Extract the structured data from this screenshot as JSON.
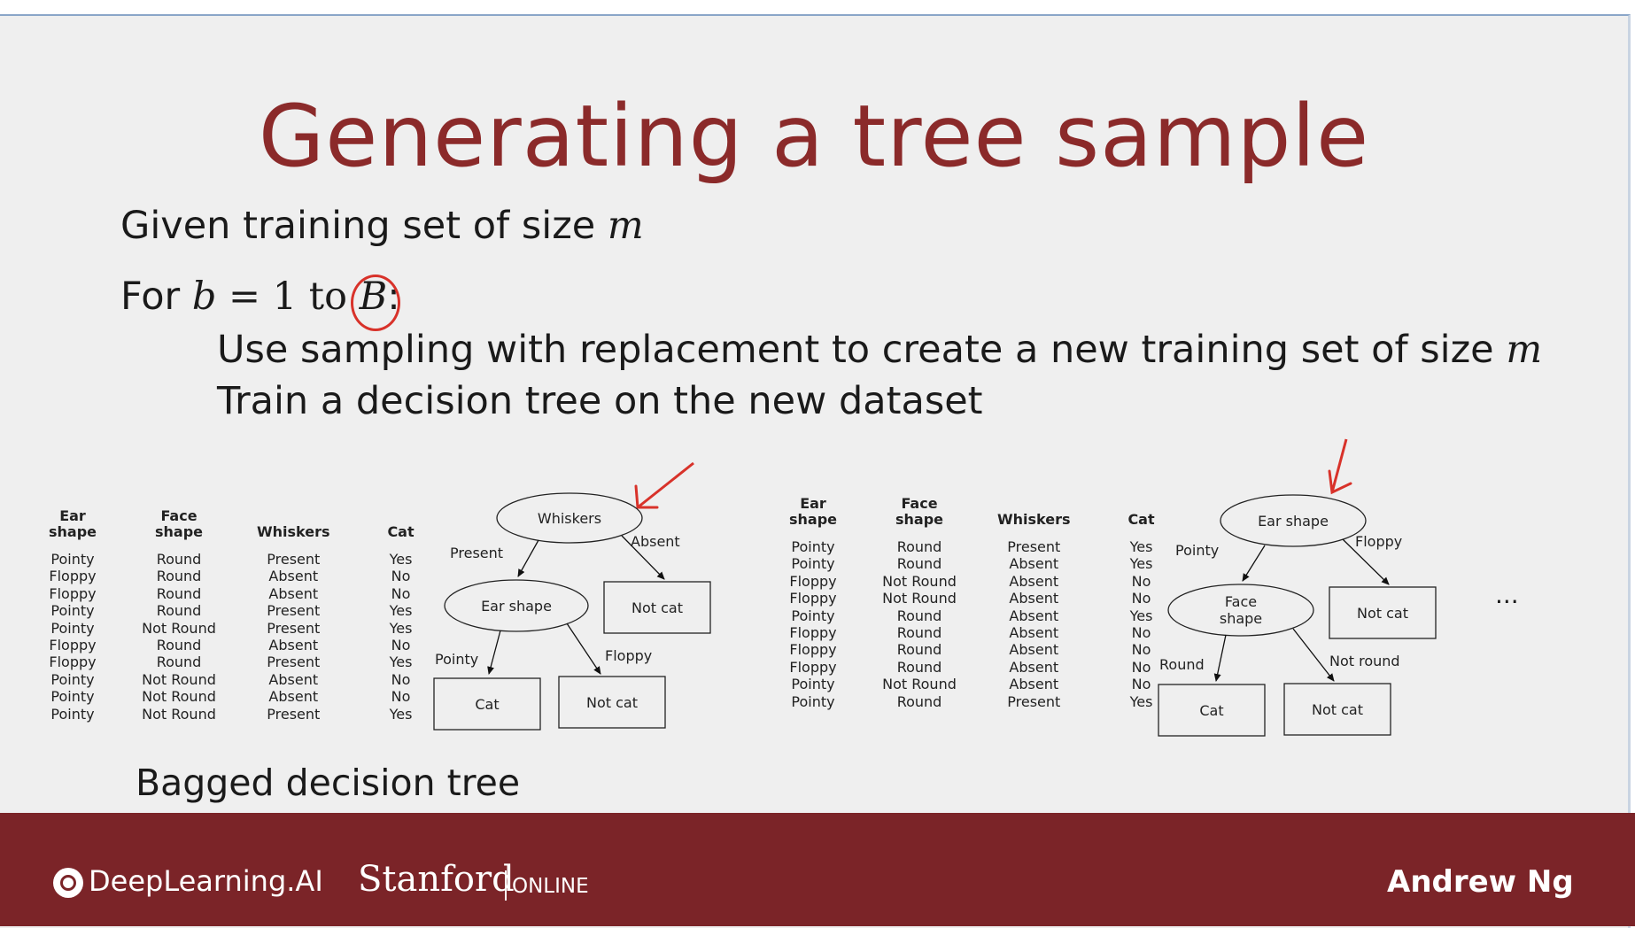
{
  "slide": {
    "title": "Generating a tree sample",
    "given": {
      "text": "Given training set of size ",
      "var": "m"
    },
    "for_line": {
      "prefix": "For ",
      "var_b": "b",
      "middle": " = 1 to",
      "var_B": "B",
      "suffix": ":"
    },
    "step1": {
      "text": "Use sampling with replacement to create a new training set of size ",
      "var": "m"
    },
    "step2": "Train a decision tree on the new dataset",
    "bagged_label": "Bagged decision tree",
    "ellipsis": "...",
    "annotation_color": "#d8322a",
    "title_color": "#8b2a2a"
  },
  "table1": {
    "headers": [
      "Ear\nshape",
      "Face\nshape",
      "Whiskers",
      "Cat"
    ],
    "rows": [
      [
        "Pointy",
        "Round",
        "Present",
        "Yes"
      ],
      [
        "Floppy",
        "Round",
        "Absent",
        "No"
      ],
      [
        "Floppy",
        "Round",
        "Absent",
        "No"
      ],
      [
        "Pointy",
        "Round",
        "Present",
        "Yes"
      ],
      [
        "Pointy",
        "Not Round",
        "Present",
        "Yes"
      ],
      [
        "Floppy",
        "Round",
        "Absent",
        "No"
      ],
      [
        "Floppy",
        "Round",
        "Present",
        "Yes"
      ],
      [
        "Pointy",
        "Not Round",
        "Absent",
        "No"
      ],
      [
        "Pointy",
        "Not Round",
        "Absent",
        "No"
      ],
      [
        "Pointy",
        "Not Round",
        "Present",
        "Yes"
      ]
    ]
  },
  "tree1": {
    "root": "Whiskers",
    "left_edge": "Present",
    "right_edge": "Absent",
    "right_leaf": "Not cat",
    "inner": "Ear shape",
    "inner_left_edge": "Pointy",
    "inner_right_edge": "Floppy",
    "leaf_left": "Cat",
    "leaf_right": "Not cat"
  },
  "table2": {
    "headers": [
      "Ear\nshape",
      "Face\nshape",
      "Whiskers",
      "Cat"
    ],
    "rows": [
      [
        "Pointy",
        "Round",
        "Present",
        "Yes"
      ],
      [
        "Pointy",
        "Round",
        "Absent",
        "Yes"
      ],
      [
        "Floppy",
        "Not Round",
        "Absent",
        "No"
      ],
      [
        "Floppy",
        "Not Round",
        "Absent",
        "No"
      ],
      [
        "Pointy",
        "Round",
        "Absent",
        "Yes"
      ],
      [
        "Floppy",
        "Round",
        "Absent",
        "No"
      ],
      [
        "Floppy",
        "Round",
        "Absent",
        "No"
      ],
      [
        "Floppy",
        "Round",
        "Absent",
        "No"
      ],
      [
        "Pointy",
        "Not Round",
        "Absent",
        "No"
      ],
      [
        "Pointy",
        "Round",
        "Present",
        "Yes"
      ]
    ]
  },
  "tree2": {
    "root": "Ear shape",
    "left_edge": "Pointy",
    "right_edge": "Floppy",
    "right_leaf": "Not cat",
    "inner_line1": "Face",
    "inner_line2": "shape",
    "inner_left_edge": "Round",
    "inner_right_edge": "Not round",
    "leaf_left": "Cat",
    "leaf_right": "Not cat"
  },
  "footer": {
    "brand": "DeepLearning.AI",
    "stanford": "Stanford",
    "online": "ONLINE",
    "author": "Andrew Ng",
    "background": "#7b2428"
  }
}
